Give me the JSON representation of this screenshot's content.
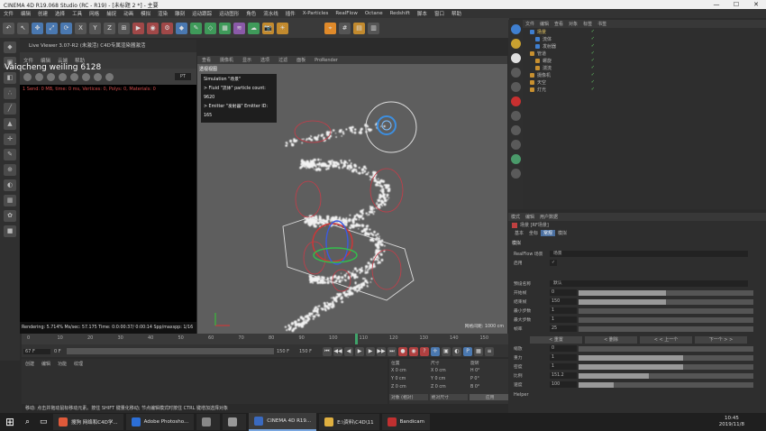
{
  "window": {
    "title": "CINEMA 4D R19.068 Studio (RC - R19) - [未标题 2 *] - 主要",
    "controls": [
      "—",
      "☐",
      "✕"
    ]
  },
  "menu": [
    "文件",
    "编辑",
    "创建",
    "选择",
    "工具",
    "网格",
    "捕捉",
    "动画",
    "模拟",
    "渲染",
    "雕刻",
    "运动跟踪",
    "运动图形",
    "角色",
    "流水线",
    "插件",
    "X-Particles",
    "RealFlow",
    "Octane",
    "Redshift",
    "脚本",
    "窗口",
    "帮助"
  ],
  "toolbar_icons": [
    "undo-icon",
    "pointer-icon",
    "move-icon",
    "scale-icon",
    "rotate-icon",
    "x-axis-icon",
    "y-axis-icon",
    "z-axis-icon",
    "coord-icon",
    "render-view-icon",
    "render-icon",
    "render-settings-icon",
    "cube-icon",
    "pen-icon",
    "subdivide-icon",
    "array-icon",
    "deformer-icon",
    "scene-icon",
    "camera-icon",
    "light-icon",
    "snap-icon",
    "grid-icon",
    "texture-icon",
    "workplane-icon"
  ],
  "liveviewer": {
    "title": "Live Viewer 3.07-R2 (未激活) C4D专属渲染器激活",
    "menu": [
      "文件",
      "编辑",
      "云端",
      "帮助"
    ],
    "error_text": "1 Send: 0 MB, time: 0 ms, Vertices: 0, Polys: 0, Materials: 0",
    "status_text": "Rendering: 5.714%  Ms/sec: 57.175  Time: 0:0:00:37/ 0:00:14  Spp/maxspp: 1/16",
    "mode": "PT"
  },
  "watermark": "Vaiqcheng weiling 6128",
  "viewport": {
    "menu": [
      "查看",
      "摄像机",
      "显示",
      "选项",
      "过滤",
      "面板",
      "ProRender"
    ],
    "label": "透视视图",
    "info_lines": [
      "Simulation \"场景\"",
      "> Fluid \"流体\" particle count: 9620",
      "> Emitter \"发射器\" Emitter ID: 165"
    ],
    "scale": "网格间距: 1000 cm"
  },
  "timeline": {
    "ticks": [
      "0",
      "10",
      "20",
      "30",
      "40",
      "50",
      "60",
      "70",
      "80",
      "90",
      "100",
      "110",
      "120",
      "130",
      "140",
      "150"
    ],
    "current_frame": "67 F",
    "start": "0 F",
    "end": "150 F",
    "frame_field": "150 F"
  },
  "materials": {
    "menu": [
      "创建",
      "编辑",
      "功能",
      "纹理"
    ]
  },
  "coords": {
    "headers": [
      "位置",
      "尺寸",
      "旋转"
    ],
    "rows": [
      [
        "X 0 cm",
        "X 0 cm",
        "H 0°"
      ],
      [
        "Y 0 cm",
        "Y 0 cm",
        "P 0°"
      ],
      [
        "Z 0 cm",
        "Z 0 cm",
        "B 0°"
      ]
    ],
    "mode": "对象 (相对)",
    "size_mode": "绝对尺寸",
    "apply": "应用"
  },
  "object_manager": {
    "menu": [
      "文件",
      "编辑",
      "查看",
      "对象",
      "标签",
      "书签"
    ],
    "items": [
      {
        "label": "场景",
        "selected": true
      },
      {
        "label": "流体",
        "selected": false
      },
      {
        "label": "发射器",
        "selected": false
      },
      {
        "label": "管道",
        "selected": false
      },
      {
        "label": "螺旋",
        "selected": false
      },
      {
        "label": "湍流",
        "selected": false
      },
      {
        "label": "摄像机",
        "selected": false
      },
      {
        "label": "天空",
        "selected": false
      },
      {
        "label": "灯光",
        "selected": false
      }
    ]
  },
  "attribute_manager": {
    "menu": [
      "模式",
      "编辑",
      "用户数据"
    ],
    "object_name": "场景 [RF场景]",
    "tabs": [
      "基本",
      "坐标",
      "常规",
      "模拟"
    ],
    "section": "模拟",
    "realflow_label": "RealFlow 场景",
    "realflow_value": "场景",
    "fields": [
      {
        "label": "启用",
        "value": "✓"
      },
      {
        "label": "预设名称",
        "value": "默认"
      }
    ],
    "rows": [
      {
        "label": "开始帧",
        "value": "0",
        "fill": 0.5
      },
      {
        "label": "结束帧",
        "value": "150",
        "fill": 0.5
      },
      {
        "label": "最小步数",
        "value": "1",
        "fill": 0.0
      },
      {
        "label": "最大步数",
        "value": "1",
        "fill": 0.0
      },
      {
        "label": "帧率",
        "value": "25",
        "fill": 0.0
      }
    ],
    "buttons": [
      "< 重置",
      "< 删除",
      "< < 上一个",
      "下一个 > >"
    ],
    "rows2": [
      {
        "label": "缩放",
        "value": "0",
        "fill": 0.0
      },
      {
        "label": "重力",
        "value": "1",
        "fill": 0.6
      },
      {
        "label": "密度",
        "value": "1",
        "fill": 0.6
      },
      {
        "label": "比例",
        "value": "151.2",
        "fill": 0.4
      },
      {
        "label": "速度",
        "value": "100",
        "fill": 0.2
      }
    ],
    "footer": "Helper"
  },
  "statusbar": "移动: 点击并拖动鼠标移动元素。按住 SHIFT 键量化移动; 节点编辑模式时按住 CTRL 键增加选择对象",
  "taskbar": {
    "items": [
      {
        "label": "搜狗 网络和C4D学...",
        "icon_color": "#e05a3a"
      },
      {
        "label": "Adobe Photosho...",
        "icon_color": "#2c6fd8"
      },
      {
        "label": "",
        "icon_color": "#888888"
      },
      {
        "label": "",
        "icon_color": "#999999"
      },
      {
        "label": "CINEMA 4D R19...",
        "icon_color": "#3a6ac0"
      },
      {
        "label": "E:\\资料\\C4D\\11",
        "icon_color": "#e0b040"
      },
      {
        "label": "Bandicam",
        "icon_color": "#c03030"
      }
    ],
    "time": "10:45",
    "date": "2019/11/8"
  }
}
